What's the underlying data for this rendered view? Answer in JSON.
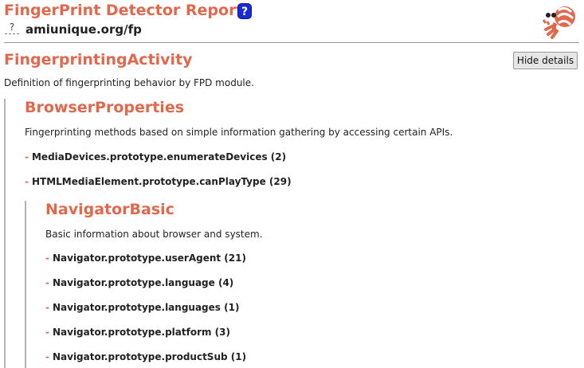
{
  "header": {
    "title": "FingerPrint Detector Report",
    "help_icon": "?",
    "site": "amiunique.org/fp",
    "logo_icon": "hermit-crab-logo-icon"
  },
  "activity": {
    "title": "FingerprintingActivity",
    "hide_button_label": "Hide details",
    "description": "Definition of fingerprinting behavior by FPD module."
  },
  "groups": [
    {
      "title": "BrowserProperties",
      "description": "Fingerprinting methods based on simple information gathering by accessing certain APIs.",
      "items": [
        "MediaDevices.prototype.enumerateDevices (2)",
        "HTMLMediaElement.prototype.canPlayType (29)"
      ]
    },
    {
      "title": "NavigatorBasic",
      "description": "Basic information about browser and system.",
      "items": [
        "Navigator.prototype.userAgent (21)",
        "Navigator.prototype.language (4)",
        "Navigator.prototype.languages (1)",
        "Navigator.prototype.platform (3)",
        "Navigator.prototype.productSub (1)"
      ]
    }
  ],
  "colors": {
    "accent": "#e2684d",
    "help_icon_bg": "#1a2bd6",
    "border": "#b3b3b3"
  }
}
